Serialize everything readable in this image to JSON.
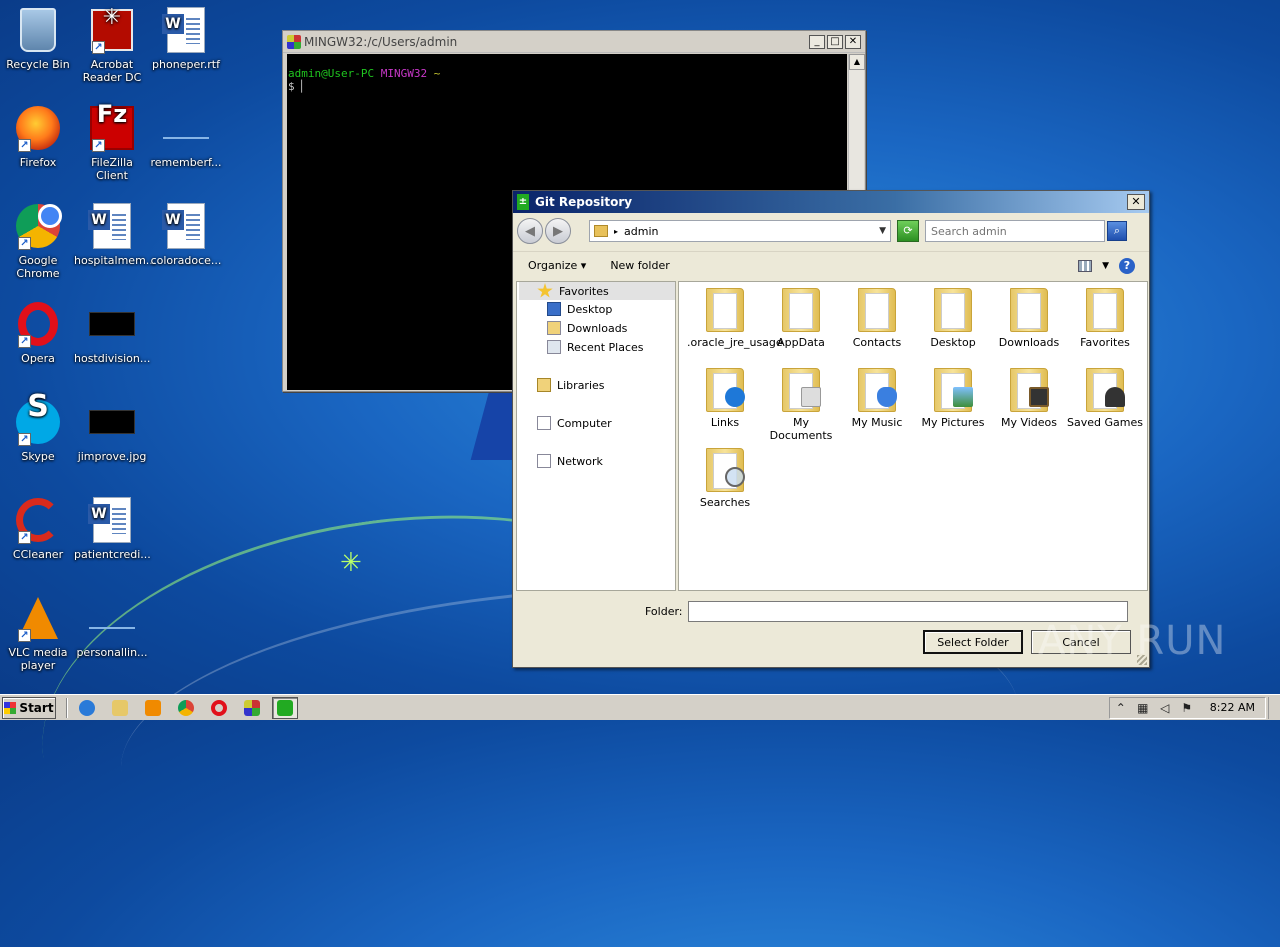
{
  "desktop": {
    "icons": [
      {
        "label": "Recycle Bin",
        "icon": "recycle-bin-icon"
      },
      {
        "label": "Acrobat Reader DC",
        "icon": "acrobat-icon"
      },
      {
        "label": "phoneper.rtf",
        "icon": "word-doc-icon"
      },
      {
        "label": "Firefox",
        "icon": "firefox-icon"
      },
      {
        "label": "FileZilla Client",
        "icon": "filezilla-icon"
      },
      {
        "label": "rememberf...",
        "icon": "file-icon"
      },
      {
        "label": "Google Chrome",
        "icon": "chrome-icon"
      },
      {
        "label": "hospitalmem...",
        "icon": "word-doc-icon"
      },
      {
        "label": "coloradoce...",
        "icon": "word-doc-icon"
      },
      {
        "label": "Opera",
        "icon": "opera-icon"
      },
      {
        "label": "hostdivision...",
        "icon": "image-file-icon"
      },
      {
        "label": "Skype",
        "icon": "skype-icon"
      },
      {
        "label": "jimprove.jpg",
        "icon": "image-file-icon"
      },
      {
        "label": "CCleaner",
        "icon": "ccleaner-icon"
      },
      {
        "label": "patientcredi...",
        "icon": "word-doc-icon"
      },
      {
        "label": "VLC media player",
        "icon": "vlc-icon"
      },
      {
        "label": "personallin...",
        "icon": "file-icon"
      }
    ]
  },
  "terminal": {
    "title": "MINGW32:/c/Users/admin",
    "prompt_user": "admin@User-PC",
    "prompt_env": "MINGW32",
    "prompt_path": "~",
    "prompt_symbol": "$"
  },
  "dialog": {
    "title": "Git Repository",
    "address": "admin",
    "search_placeholder": "Search admin",
    "organize_label": "Organize",
    "new_folder_label": "New folder",
    "nav": {
      "favorites": "Favorites",
      "desktop": "Desktop",
      "downloads": "Downloads",
      "recent": "Recent Places",
      "libraries": "Libraries",
      "computer": "Computer",
      "network": "Network"
    },
    "items": [
      {
        "label": ".oracle_jre_usage",
        "badge": "none"
      },
      {
        "label": "AppData",
        "badge": "none"
      },
      {
        "label": "Contacts",
        "badge": "none"
      },
      {
        "label": "Desktop",
        "badge": "none"
      },
      {
        "label": "Downloads",
        "badge": "none"
      },
      {
        "label": "Favorites",
        "badge": "none"
      },
      {
        "label": "Links",
        "badge": "links"
      },
      {
        "label": "My Documents",
        "badge": "docs"
      },
      {
        "label": "My Music",
        "badge": "music"
      },
      {
        "label": "My Pictures",
        "badge": "pics"
      },
      {
        "label": "My Videos",
        "badge": "videos"
      },
      {
        "label": "Saved Games",
        "badge": "games"
      },
      {
        "label": "Searches",
        "badge": "search"
      }
    ],
    "folder_label": "Folder:",
    "folder_value": "",
    "select_button": "Select Folder",
    "cancel_button": "Cancel"
  },
  "watermark": "ANY RUN",
  "taskbar": {
    "start_label": "Start",
    "clock": "8:22 AM"
  },
  "colors": {
    "title_active": "#0a246a",
    "terminal_green": "#1fc41f",
    "terminal_magenta": "#c838c8",
    "terminal_yellow": "#c8c832"
  }
}
